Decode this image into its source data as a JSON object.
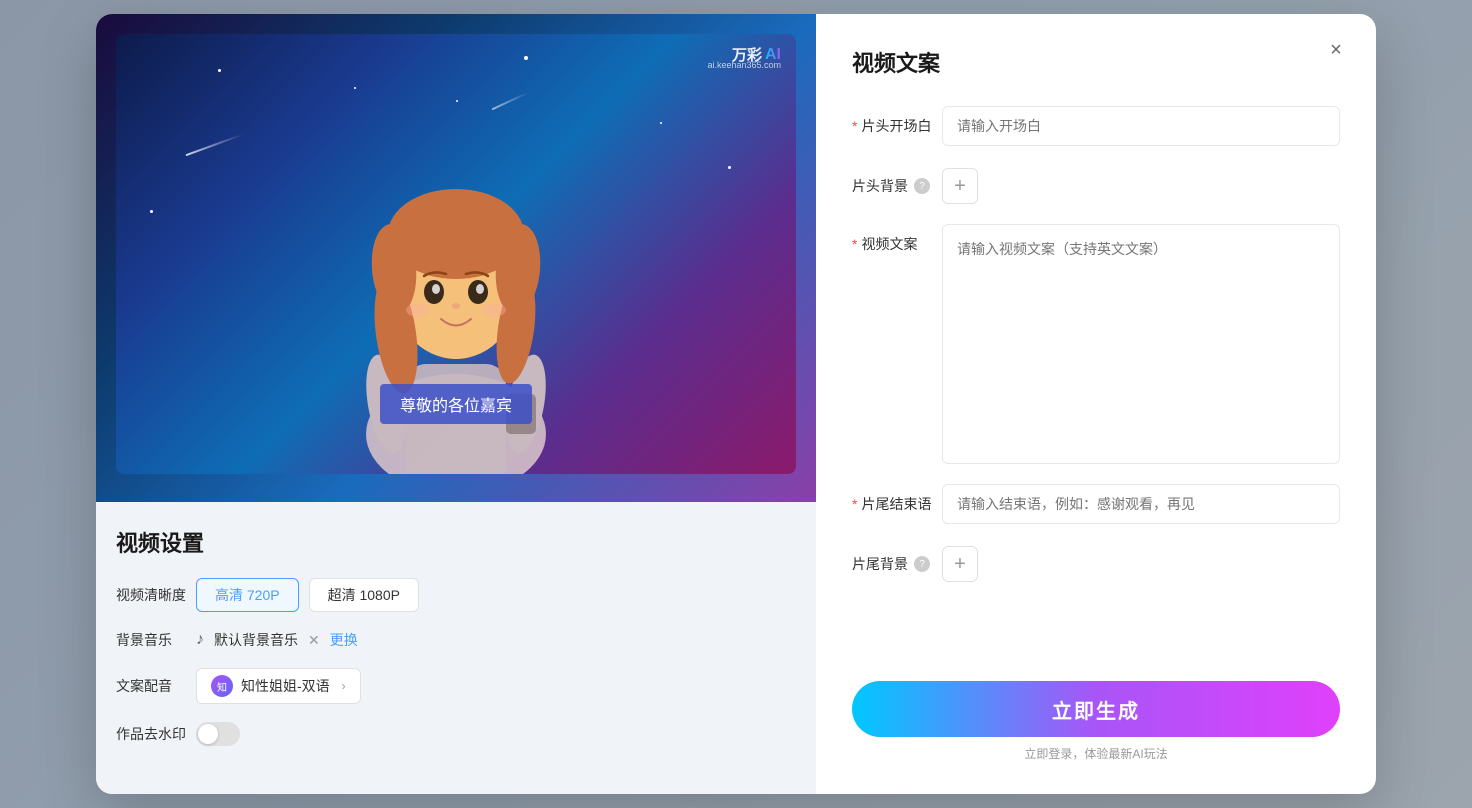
{
  "background": {
    "color": "#dce8f5"
  },
  "modal": {
    "left_panel": {
      "preview": {
        "watermark_brand": "万彩",
        "watermark_ai": "AI",
        "watermark_site": "ai.keehan365.com",
        "subtitle_text": "尊敬的各位嘉宾"
      },
      "settings_title": "视频设置",
      "video_quality_label": "视频清晰度",
      "quality_options": [
        {
          "label": "高清 720P",
          "active": true
        },
        {
          "label": "超清 1080P",
          "active": false
        }
      ],
      "bg_music_label": "背景音乐",
      "music_name": "默认背景音乐",
      "music_change": "更换",
      "voice_label": "文案配音",
      "voice_name": "知性姐姐-双语",
      "watermark_label": "作品去水印"
    },
    "right_panel": {
      "title": "视频文案",
      "close_label": "×",
      "fields": {
        "opening_label": "片头开场白",
        "opening_required": true,
        "opening_placeholder": "请输入开场白",
        "bg_label": "片头背景",
        "bg_has_help": true,
        "bg_add_label": "+",
        "content_label": "视频文案",
        "content_required": true,
        "content_placeholder": "请输入视频文案（支持英文文案）",
        "closing_label": "片尾结束语",
        "closing_required": true,
        "closing_placeholder": "请输入结束语，例如：感谢观看，再见",
        "tail_bg_label": "片尾背景",
        "tail_bg_has_help": true,
        "tail_bg_add_label": "+"
      },
      "generate_btn": "立即生成",
      "generate_sub": "立即登录，体验最新AI玩法"
    }
  }
}
